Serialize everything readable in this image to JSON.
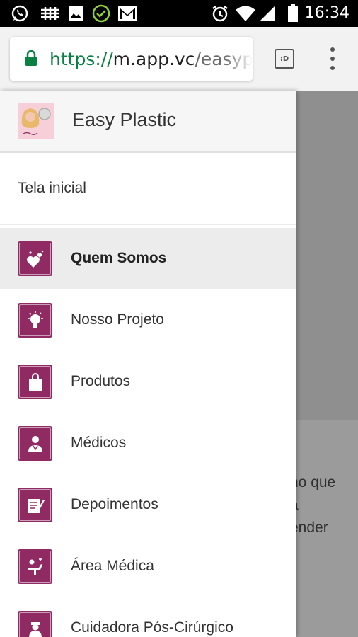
{
  "status_bar": {
    "time": "16:34",
    "left_icons": [
      "whatsapp-icon",
      "signal-strength-icon",
      "image-icon",
      "check-circle-icon",
      "gmail-icon"
    ],
    "right_icons": [
      "alarm-icon",
      "wifi-icon",
      "cell-signal-icon",
      "battery-icon"
    ]
  },
  "browser": {
    "url_scheme": "https://",
    "url_domain": "m.app.vc",
    "url_path": "/easypla",
    "tab_count": ":D"
  },
  "drawer": {
    "app_title": "Easy Plastic",
    "home_label": "Tela inicial",
    "items": [
      {
        "label": "Quem Somos",
        "icon": "hearts-icon",
        "active": true
      },
      {
        "label": "Nosso Projeto",
        "icon": "lightbulb-icon",
        "active": false
      },
      {
        "label": "Produtos",
        "icon": "shopping-bag-icon",
        "active": false
      },
      {
        "label": "Médicos",
        "icon": "doctor-icon",
        "active": false
      },
      {
        "label": "Depoimentos",
        "icon": "testimonial-icon",
        "active": false
      },
      {
        "label": "Área Médica",
        "icon": "medical-area-icon",
        "active": false
      },
      {
        "label": "Cuidadora Pós-Cirúrgico",
        "icon": "caregiver-icon",
        "active": false
      }
    ]
  },
  "background_page": {
    "lines": [
      "no que",
      "a",
      "ender"
    ]
  },
  "colors": {
    "accent": "#8f2a62",
    "https_green": "#0b8043",
    "status_bar": "#000000"
  }
}
